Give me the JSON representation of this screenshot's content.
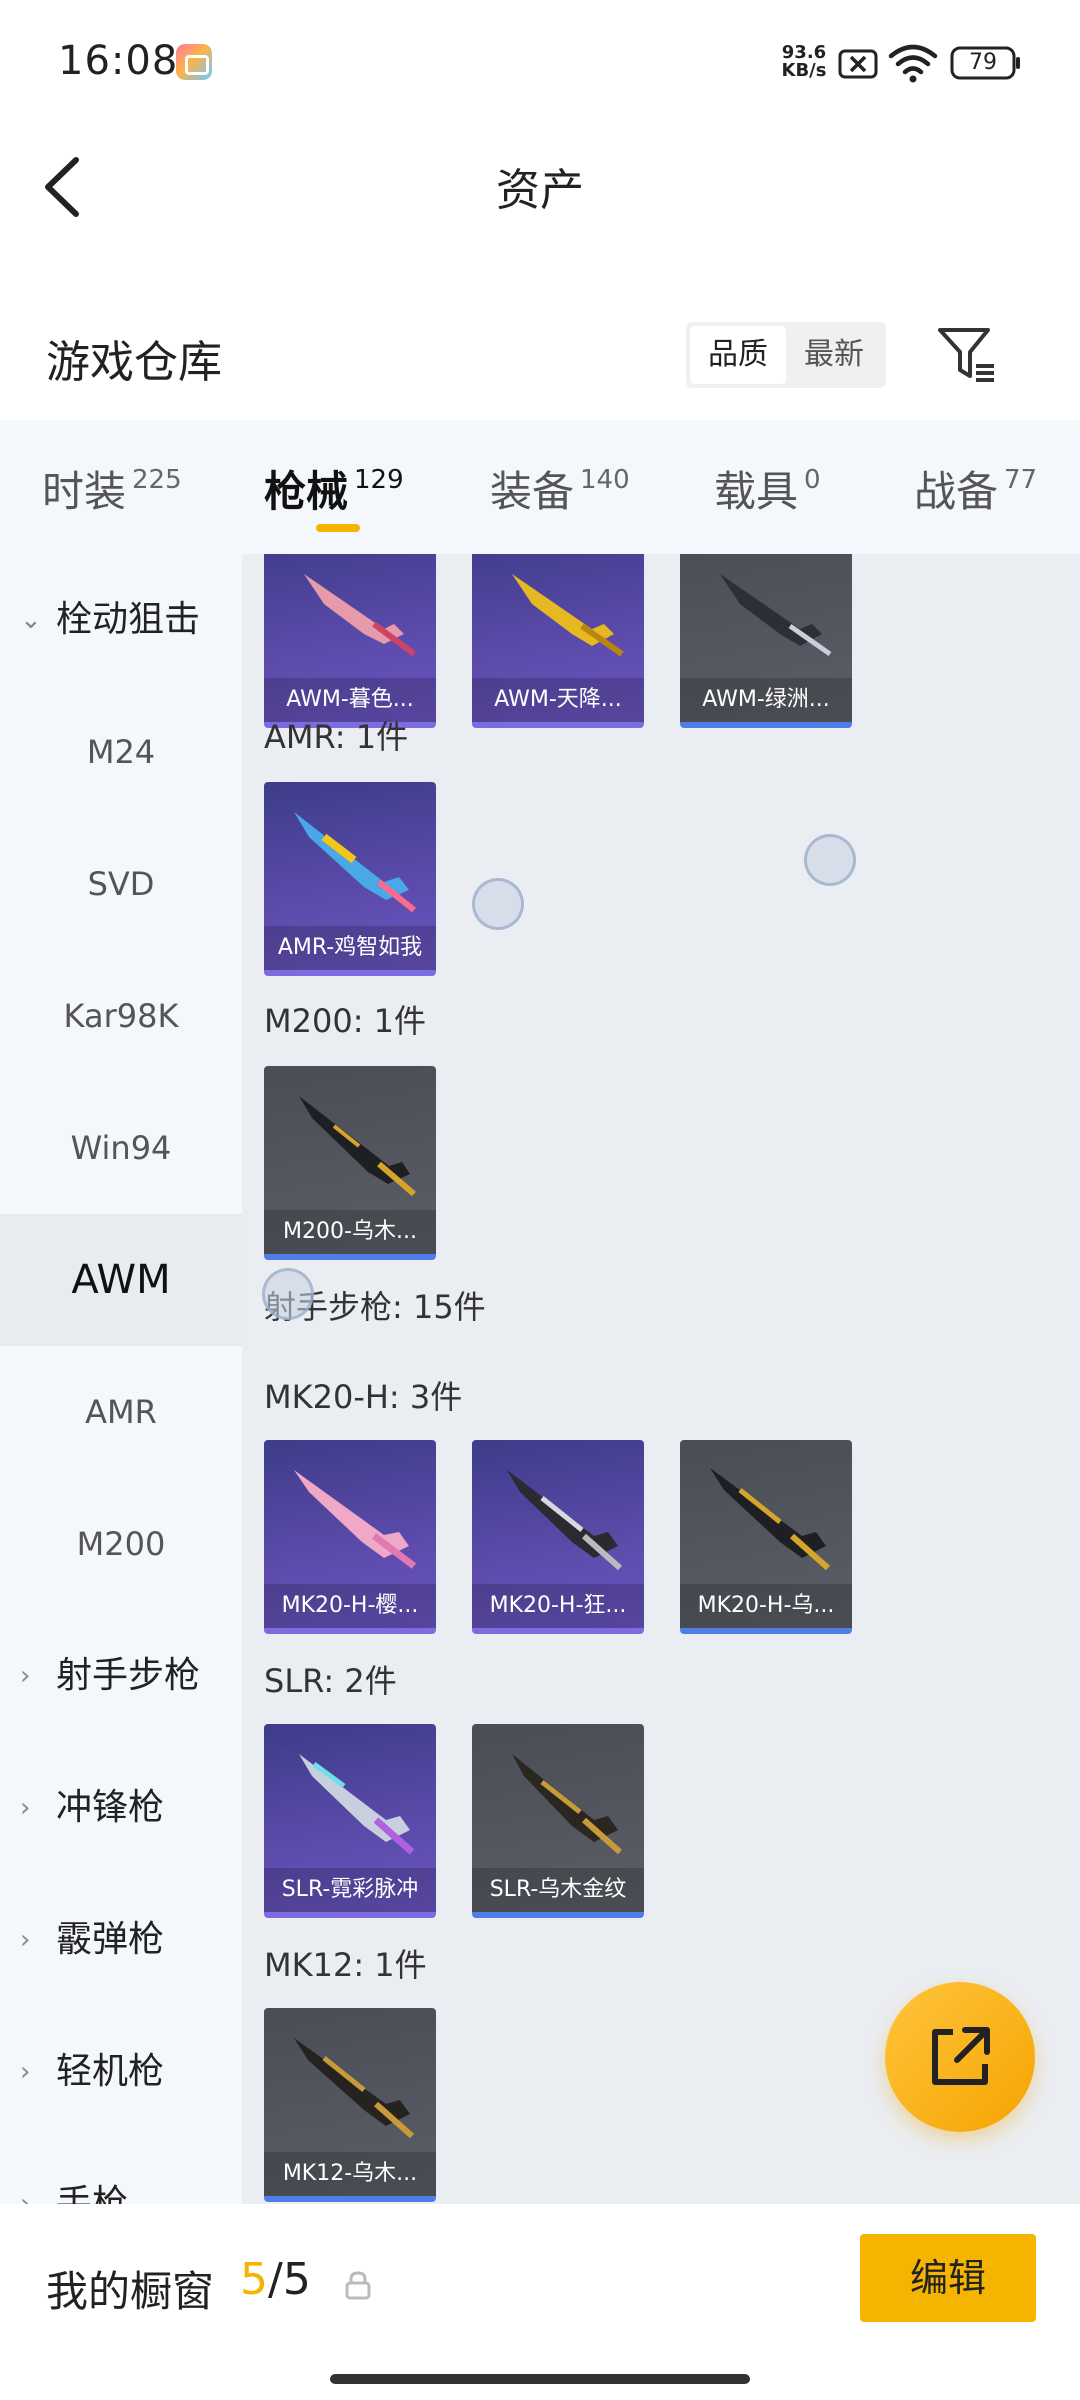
{
  "status_bar": {
    "time": "16:08",
    "net_speed_value": "93.6",
    "net_speed_unit": "KB/s",
    "battery": "79"
  },
  "header": {
    "title": "资产"
  },
  "warehouse": {
    "title": "游戏仓库",
    "sort_options": [
      "品质",
      "最新"
    ],
    "sort_selected": "品质"
  },
  "tabs": [
    {
      "label": "时装",
      "count": "225"
    },
    {
      "label": "枪械",
      "count": "129",
      "active": true
    },
    {
      "label": "装备",
      "count": "140"
    },
    {
      "label": "载具",
      "count": "0"
    },
    {
      "label": "战备",
      "count": "77"
    }
  ],
  "sidebar": {
    "group_open": "栓动狙击",
    "items": [
      "M24",
      "SVD",
      "Kar98K",
      "Win94",
      "AWM",
      "AMR",
      "M200"
    ],
    "selected": "AWM",
    "groups_collapsed": [
      "射手步枪",
      "冲锋枪",
      "霰弹枪",
      "轻机枪",
      "手枪"
    ]
  },
  "content": {
    "top_cards": [
      "AWM-暮色...",
      "AWM-天降...",
      "AWM-绿洲..."
    ],
    "sections": [
      {
        "heading": "AMR: 1件",
        "cards": [
          "AMR-鸡智如我"
        ]
      },
      {
        "heading": "M200: 1件",
        "cards": [
          "M200-乌木..."
        ]
      },
      {
        "heading": "射手步枪: 15件"
      },
      {
        "heading": "MK20-H: 3件",
        "cards": [
          "MK20-H-樱...",
          "MK20-H-狂...",
          "MK20-H-乌..."
        ]
      },
      {
        "heading": "SLR: 2件",
        "cards": [
          "SLR-霓彩脉冲",
          "SLR-乌木金纹"
        ]
      },
      {
        "heading": "MK12: 1件",
        "cards": [
          "MK12-乌木..."
        ]
      }
    ]
  },
  "bottom_bar": {
    "label": "我的橱窗",
    "count_current": "5",
    "count_sep_total": "/5",
    "edit_label": "编辑"
  },
  "colors": {
    "accent": "#f5b400",
    "card_purple": "#5a4aa8",
    "card_gray": "#55585f",
    "sidebar_bg": "#f4f7fb",
    "content_bg": "#eaedf1"
  }
}
